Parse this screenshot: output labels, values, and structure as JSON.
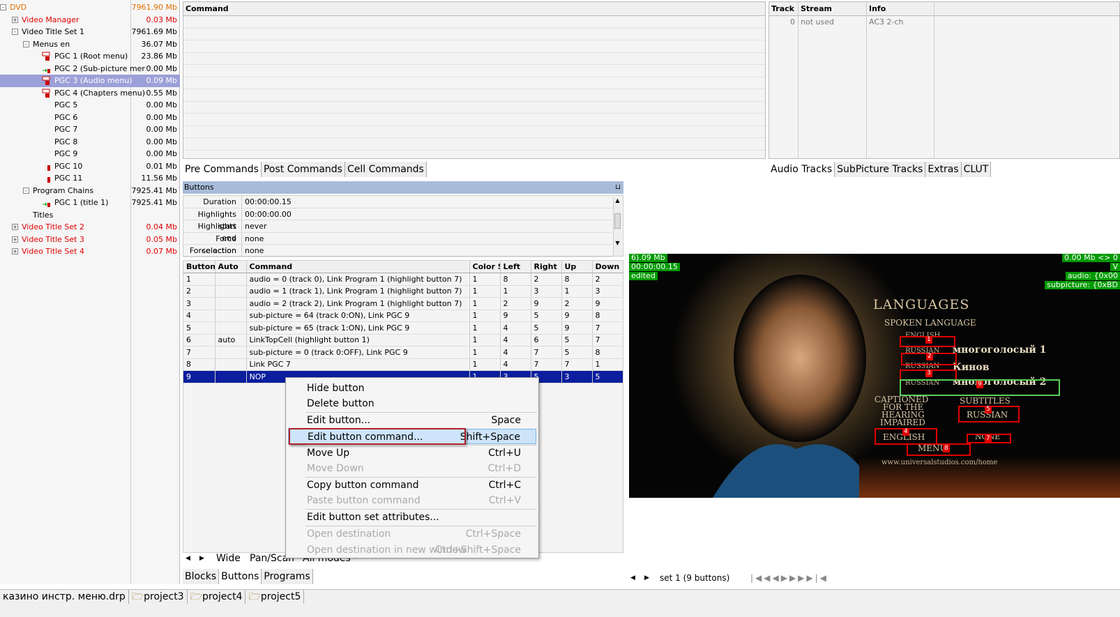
{
  "tree": [
    {
      "label": "DVD",
      "size": "7961.90 Mb",
      "color": "orange",
      "expand": "-",
      "lvl": 0
    },
    {
      "label": "Video Manager",
      "size": "0.03 Mb",
      "color": "red",
      "expand": "+",
      "lvl": 1
    },
    {
      "label": "Video Title Set 1",
      "size": "7961.69 Mb",
      "color": "black",
      "expand": "-",
      "lvl": 1
    },
    {
      "label": "Menus en",
      "size": "36.07 Mb",
      "color": "black",
      "expand": "-",
      "lvl": 2
    },
    {
      "label": "PGC 1 (Root menu)",
      "size": "23.86 Mb",
      "color": "black",
      "icon": "menu",
      "lvl": 3
    },
    {
      "label": "PGC 2 (Sub-picture mer",
      "size": "0.00 Mb",
      "color": "black",
      "icon": "arrow",
      "lvl": 3
    },
    {
      "label": "PGC 3 (Audio menu)",
      "size": "0.09 Mb",
      "color": "black",
      "icon": "menu",
      "lvl": 3,
      "sel": true
    },
    {
      "label": "PGC 4 (Chapters menu)",
      "size": "0.55 Mb",
      "color": "black",
      "icon": "menu",
      "lvl": 3
    },
    {
      "label": "PGC 5",
      "size": "0.00 Mb",
      "color": "black",
      "lvl": 3
    },
    {
      "label": "PGC 6",
      "size": "0.00 Mb",
      "color": "black",
      "lvl": 3
    },
    {
      "label": "PGC 7",
      "size": "0.00 Mb",
      "color": "black",
      "lvl": 3
    },
    {
      "label": "PGC 8",
      "size": "0.00 Mb",
      "color": "black",
      "lvl": 3
    },
    {
      "label": "PGC 9",
      "size": "0.00 Mb",
      "color": "black",
      "lvl": 3
    },
    {
      "label": "PGC 10",
      "size": "0.01 Mb",
      "color": "black",
      "icon": "bar",
      "lvl": 3
    },
    {
      "label": "PGC 11",
      "size": "11.56 Mb",
      "color": "black",
      "icon": "bar",
      "lvl": 3
    },
    {
      "label": "Program Chains",
      "size": "7925.41 Mb",
      "color": "black",
      "expand": "-",
      "lvl": 2
    },
    {
      "label": "PGC 1  (title 1)",
      "size": "7925.41 Mb",
      "color": "black",
      "icon": "arrow",
      "lvl": 3
    },
    {
      "label": "Titles",
      "size": "",
      "color": "black",
      "lvl": 2
    },
    {
      "label": "Video Title Set 2",
      "size": "0.04 Mb",
      "color": "red",
      "expand": "+",
      "lvl": 1
    },
    {
      "label": "Video Title Set 3",
      "size": "0.05 Mb",
      "color": "red",
      "expand": "+",
      "lvl": 1
    },
    {
      "label": "Video Title Set 4",
      "size": "0.07 Mb",
      "color": "red",
      "expand": "+",
      "lvl": 1
    }
  ],
  "commands": {
    "header": "Command",
    "tabs": [
      "Pre Commands",
      "Post Commands",
      "Cell Commands"
    ]
  },
  "tracks": {
    "headers": [
      "Track",
      "Stream",
      "Info"
    ],
    "row": [
      "0",
      "not used",
      "AC3 2-ch"
    ],
    "tabs": [
      "Audio Tracks",
      "SubPicture Tracks",
      "Extras",
      "CLUT"
    ]
  },
  "buttons_panel": {
    "title": "Buttons",
    "props": [
      [
        "Duration",
        "00:00:00.15"
      ],
      [
        "Highlights start",
        "00:00:00.00"
      ],
      [
        "Highlights end",
        "never"
      ],
      [
        "Force selection",
        "none"
      ],
      [
        "Force action",
        "none"
      ]
    ]
  },
  "btable": {
    "headers": [
      "Button",
      "Auto",
      "Command",
      "Color S",
      "Left",
      "Right",
      "Up",
      "Down"
    ],
    "rows": [
      [
        "1",
        "",
        "audio = 0 (track 0), Link Program 1 (highlight button 7)",
        "1",
        "8",
        "2",
        "8",
        "2"
      ],
      [
        "2",
        "",
        "audio = 1 (track 1), Link Program 1 (highlight button 7)",
        "1",
        "1",
        "3",
        "1",
        "3"
      ],
      [
        "3",
        "",
        "audio = 2 (track 2), Link Program 1 (highlight button 7)",
        "1",
        "2",
        "9",
        "2",
        "9"
      ],
      [
        "4",
        "",
        "sub-picture = 64 (track 0:ON), Link PGC 9",
        "1",
        "9",
        "5",
        "9",
        "8"
      ],
      [
        "5",
        "",
        "sub-picture = 65 (track 1:ON), Link PGC 9",
        "1",
        "4",
        "5",
        "9",
        "7"
      ],
      [
        "6",
        "auto",
        "LinkTopCell (highlight button 1)",
        "1",
        "4",
        "6",
        "5",
        "7"
      ],
      [
        "7",
        "",
        "sub-picture = 0 (track 0:OFF), Link PGC 9",
        "1",
        "4",
        "7",
        "5",
        "8"
      ],
      [
        "8",
        "",
        "Link PGC 7",
        "1",
        "4",
        "7",
        "7",
        "1"
      ],
      [
        "9",
        "",
        "NOP",
        "1",
        "3",
        "5",
        "3",
        "5"
      ]
    ]
  },
  "context_menu": [
    {
      "label": "Hide button",
      "sc": "",
      "dis": false
    },
    {
      "label": "Delete button",
      "sc": "",
      "dis": false,
      "sep": true
    },
    {
      "label": "Edit button...",
      "sc": "Space",
      "dis": false
    },
    {
      "label": "Edit button command...",
      "sc": "Shift+Space",
      "dis": false,
      "hi": true,
      "sep": true
    },
    {
      "label": "Move Up",
      "sc": "Ctrl+U",
      "dis": false
    },
    {
      "label": "Move Down",
      "sc": "Ctrl+D",
      "dis": true,
      "sep": true
    },
    {
      "label": "Copy button command",
      "sc": "Ctrl+C",
      "dis": false
    },
    {
      "label": "Paste button command",
      "sc": "Ctrl+V",
      "dis": true,
      "sep": true
    },
    {
      "label": "Edit button set attributes...",
      "sc": "",
      "dis": false,
      "sep": true
    },
    {
      "label": "Open destination",
      "sc": "Ctrl+Space",
      "dis": true
    },
    {
      "label": "Open destination in new window",
      "sc": "Ctrl+Shift+Space",
      "dis": true
    }
  ],
  "bottom_tabs": {
    "wide": [
      "Wide",
      "Pan/Scan",
      "All modes"
    ],
    "main": [
      "Blocks",
      "Buttons",
      "Programs"
    ]
  },
  "preview": {
    "tl": [
      "6).09 Mb",
      "00:00:00.15",
      "edited"
    ],
    "tr": [
      "0.00 Mb <> 0",
      "V",
      "audio: {0x00",
      "subpicture: {0xBD"
    ],
    "title": "LANGUAGES",
    "spoken": "SPOKEN LANGUAGE",
    "english": "ENGLISH",
    "russian1": "RUSSIAN",
    "ru1": "многоголосый  1",
    "russian2": "RUSSIAN",
    "ru2": "Кинов",
    "russian3": "RUSSIAN",
    "ru3": "многоголосый  2",
    "captioned": "CAPTIONED",
    "forthe": "FOR THE",
    "hearing": "HEARING",
    "impaired": "IMPAIRED",
    "subtitles": "SUBTITLES",
    "sub_russian": "RUSSIAN",
    "sub_english": "ENGLISH",
    "none": "NONE",
    "menu": "MENU",
    "url": "www.universalstudios.com/home"
  },
  "nav": {
    "set": "set 1 (9 buttons)"
  },
  "status": [
    "казино инстр. меню.drp",
    "project3",
    "project4",
    "project5"
  ]
}
